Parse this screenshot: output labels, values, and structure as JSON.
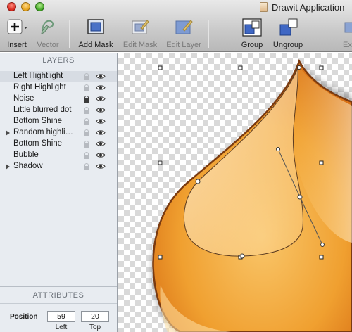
{
  "window": {
    "title": "Drawit Application"
  },
  "toolbar": {
    "insert": "Insert",
    "vector": "Vector",
    "add_mask": "Add Mask",
    "edit_mask": "Edit Mask",
    "edit_layer": "Edit Layer",
    "group": "Group",
    "ungroup": "Ungroup",
    "export": "Ex"
  },
  "sidebar": {
    "layers_title": "LAYERS",
    "layers": [
      {
        "name": "Left Hightlight",
        "selected": true,
        "expandable": false,
        "locked": false
      },
      {
        "name": "Right Highlight",
        "selected": false,
        "expandable": false,
        "locked": false
      },
      {
        "name": "Noise",
        "selected": false,
        "expandable": false,
        "locked": true
      },
      {
        "name": "Little blurred dot",
        "selected": false,
        "expandable": false,
        "locked": false
      },
      {
        "name": "Bottom Shine",
        "selected": false,
        "expandable": false,
        "locked": false
      },
      {
        "name": "Random highli…",
        "selected": false,
        "expandable": true,
        "locked": false
      },
      {
        "name": "Bottom Shine",
        "selected": false,
        "expandable": false,
        "locked": false
      },
      {
        "name": "Bubble",
        "selected": false,
        "expandable": false,
        "locked": false
      },
      {
        "name": "Shadow",
        "selected": false,
        "expandable": true,
        "locked": false
      }
    ],
    "attributes_title": "ATTRIBUTES",
    "position": {
      "label": "Position",
      "left": "59",
      "top": "20",
      "left_label": "Left",
      "top_label": "Top"
    }
  },
  "colors": {
    "drop_light": "#f7b347",
    "drop_dark": "#d6640c",
    "outline": "#7a3a10",
    "selection": "#d7dce3"
  }
}
